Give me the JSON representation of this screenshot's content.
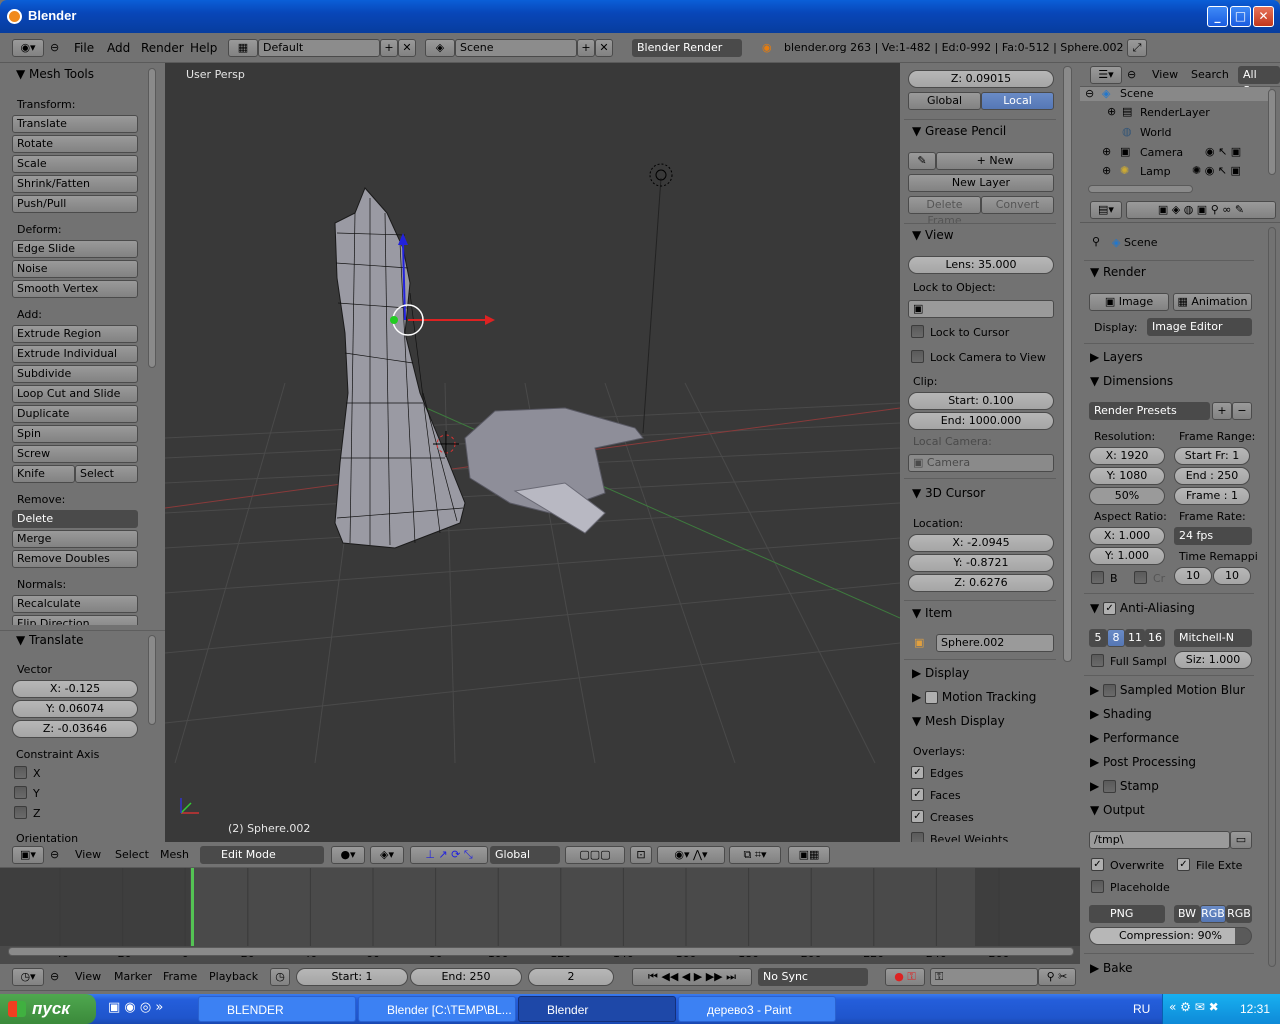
{
  "window": {
    "title": "Blender"
  },
  "info_header": {
    "menus": [
      "File",
      "Add",
      "Render",
      "Help"
    ],
    "screen": "Default",
    "scene": "Scene",
    "engine": "Blender Render",
    "stats": "blender.org 263 | Ve:1-482 | Ed:0-992 | Fa:0-512 | Sphere.002"
  },
  "toolshelf": {
    "title": "Mesh Tools",
    "transform_label": "Transform:",
    "transform": [
      "Translate",
      "Rotate",
      "Scale",
      "Shrink/Fatten",
      "Push/Pull"
    ],
    "deform_label": "Deform:",
    "deform": [
      "Edge Slide",
      "Noise",
      "Smooth Vertex"
    ],
    "add_label": "Add:",
    "add": [
      "Extrude Region",
      "Extrude Individual",
      "Subdivide",
      "Loop Cut and Slide",
      "Duplicate",
      "Spin",
      "Screw"
    ],
    "knife": "Knife",
    "select": "Select",
    "remove_label": "Remove:",
    "delete": "Delete",
    "merge": "Merge",
    "remove_doubles": "Remove Doubles",
    "normals_label": "Normals:",
    "recalculate": "Recalculate",
    "flip_direction": "Flip Direction"
  },
  "operator_panel": {
    "title": "Translate",
    "vector_label": "Vector",
    "x": "X: -0.125",
    "y": "Y: 0.06074",
    "z": "Z: -0.03646",
    "constraint_label": "Constraint Axis",
    "axes": [
      "X",
      "Y",
      "Z"
    ],
    "orientation": "Orientation"
  },
  "viewport": {
    "view_name": "User Persp",
    "object_name": "(2) Sphere.002"
  },
  "npanel": {
    "z_value": "Z: 0.09015",
    "global": "Global",
    "local": "Local",
    "grease_pencil": "Grease Pencil",
    "new": "New",
    "new_layer": "New Layer",
    "delete_frame": "Delete Frame",
    "convert": "Convert",
    "view": "View",
    "lens": "Lens: 35.000",
    "lock_to_object": "Lock to Object:",
    "lock_to_cursor": "Lock to Cursor",
    "lock_camera": "Lock Camera to View",
    "clip": "Clip:",
    "clip_start": "Start: 0.100",
    "clip_end": "End: 1000.000",
    "local_camera": "Local Camera:",
    "camera": "Camera",
    "cursor_3d": "3D Cursor",
    "location": "Location:",
    "loc_x": "X: -2.0945",
    "loc_y": "Y: -0.8721",
    "loc_z": "Z: 0.6276",
    "item": "Item",
    "item_name": "Sphere.002",
    "display": "Display",
    "motion_tracking": "Motion Tracking",
    "mesh_display": "Mesh Display",
    "overlays": "Overlays:",
    "edges": "Edges",
    "faces": "Faces",
    "creases": "Creases",
    "bevel_weights": "Bevel Weights"
  },
  "view3d_header": {
    "menus": [
      "View",
      "Select",
      "Mesh"
    ],
    "mode": "Edit Mode",
    "orientation": "Global"
  },
  "timeline": {
    "ticks": [
      "-40",
      "-20",
      "0",
      "20",
      "40",
      "60",
      "80",
      "100",
      "120",
      "140",
      "160",
      "180",
      "200",
      "220",
      "240",
      "260"
    ],
    "menus": [
      "View",
      "Marker",
      "Frame",
      "Playback"
    ],
    "start": "Start: 1",
    "end": "End: 250",
    "current": "2",
    "sync": "No Sync"
  },
  "outliner": {
    "menus": [
      "View",
      "Search"
    ],
    "filter": "All Sce",
    "items": [
      "Scene",
      "RenderLayer",
      "World",
      "Camera",
      "Lamp"
    ]
  },
  "properties": {
    "context": "Scene",
    "render": "Render",
    "image": "Image",
    "animation": "Animation",
    "display_label": "Display:",
    "display_value": "Image Editor",
    "layers": "Layers",
    "dimensions": "Dimensions",
    "render_presets": "Render Presets",
    "resolution": "Resolution:",
    "res_x": "X: 1920",
    "res_y": "Y: 1080",
    "res_pct": "50%",
    "frame_range": "Frame Range:",
    "start_fr": "Start Fr: 1",
    "end_fr": "End : 250",
    "frame_fr": "Frame : 1",
    "aspect": "Aspect Ratio:",
    "asp_x": "X: 1.000",
    "asp_y": "Y: 1.000",
    "frame_rate": "Frame Rate:",
    "fps": "24 fps",
    "time_remap": "Time Remappi",
    "remap_old": "10",
    "remap_new": "10",
    "b": "B",
    "cr": "Cr",
    "anti_aliasing": "Anti-Aliasing",
    "aa_samples": [
      "5",
      "8",
      "11",
      "16"
    ],
    "aa_filter": "Mitchell-N",
    "full_sample": "Full Sampl",
    "size": "Siz: 1.000",
    "motion_blur": "Sampled Motion Blur",
    "shading": "Shading",
    "performance": "Performance",
    "post_processing": "Post Processing",
    "stamp": "Stamp",
    "output": "Output",
    "path": "/tmp\\",
    "overwrite": "Overwrite",
    "file_ext": "File Exte",
    "placeholders": "Placeholde",
    "format": "PNG",
    "bw": "BW",
    "rgb": "RGB",
    "rgba": "RGB",
    "compression": "Compression: 90%",
    "bake": "Bake"
  },
  "taskbar": {
    "start": "пуск",
    "tasks": [
      "BLENDER",
      "Blender [C:\\TEMP\\BL...",
      "Blender",
      "дерево3 - Paint"
    ],
    "lang": "RU",
    "time": "12:31"
  }
}
